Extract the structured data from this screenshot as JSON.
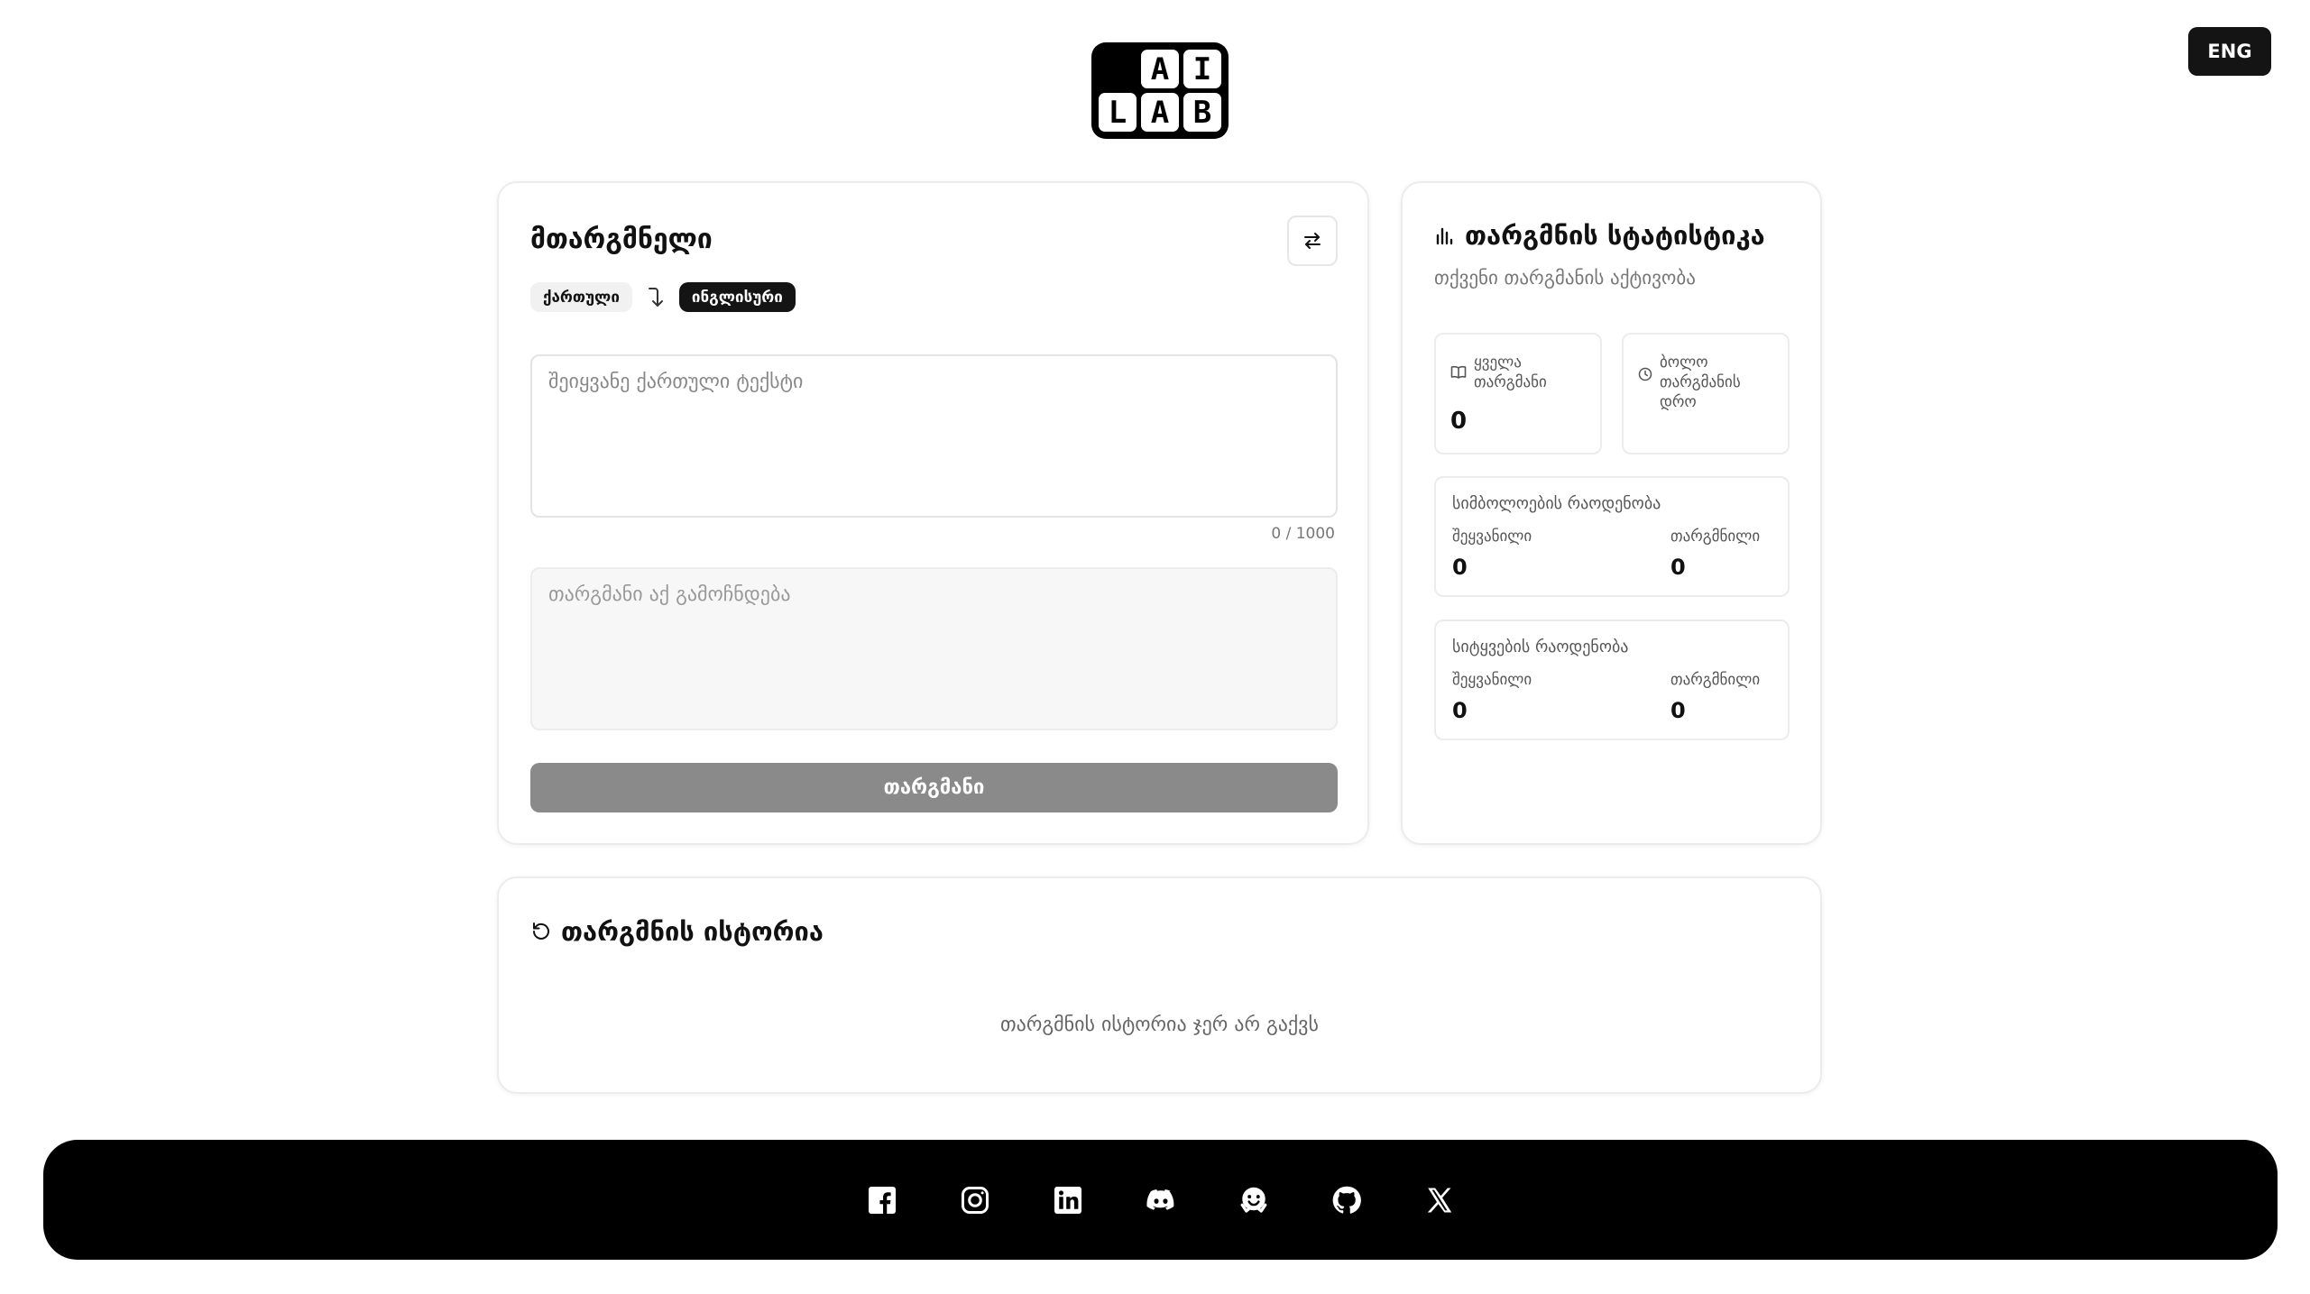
{
  "language_toggle": {
    "label": "ENG"
  },
  "logo": {
    "row1": [
      "A",
      "I"
    ],
    "row2": [
      "L",
      "A",
      "B"
    ]
  },
  "translator": {
    "title": "მთარგმნელი",
    "source_language": "ქართული",
    "target_language": "ინგლისური",
    "input_placeholder": "შეიყვანე ქართული ტექსტი",
    "char_counter": "0 / 1000",
    "output_placeholder": "თარგმანი აქ გამოჩნდება",
    "translate_button": "თარგმანი",
    "swap_icon": "swap-arrows-icon"
  },
  "stats": {
    "title": "თარგმნის სტატისტიკა",
    "subtitle": "თქვენი თარგმანის აქტივობა",
    "total": {
      "label_line1": "ყველა",
      "label_line2": "თარგმანი",
      "value": "0"
    },
    "last": {
      "label_line1": "ბოლო",
      "label_line2": "თარგმანის",
      "label_line3": "დრო"
    },
    "characters": {
      "title": "სიმბოლოების რაოდენობა",
      "input_label": "შეყვანილი",
      "input_value": "0",
      "translated_label": "თარგმნილი",
      "translated_value": "0"
    },
    "sentences": {
      "title": "სიტყვების რაოდენობა",
      "input_label": "შეყვანილი",
      "input_value": "0",
      "translated_label": "თარგმნილი",
      "translated_value": "0"
    }
  },
  "history": {
    "title": "თარგმნის ისტორია",
    "empty_message": "თარგმნის ისტორია ჯერ არ გაქვს"
  },
  "footer": {
    "icons": [
      "facebook-icon",
      "instagram-icon",
      "linkedin-icon",
      "discord-icon",
      "huggingface-icon",
      "github-icon",
      "x-icon"
    ]
  }
}
